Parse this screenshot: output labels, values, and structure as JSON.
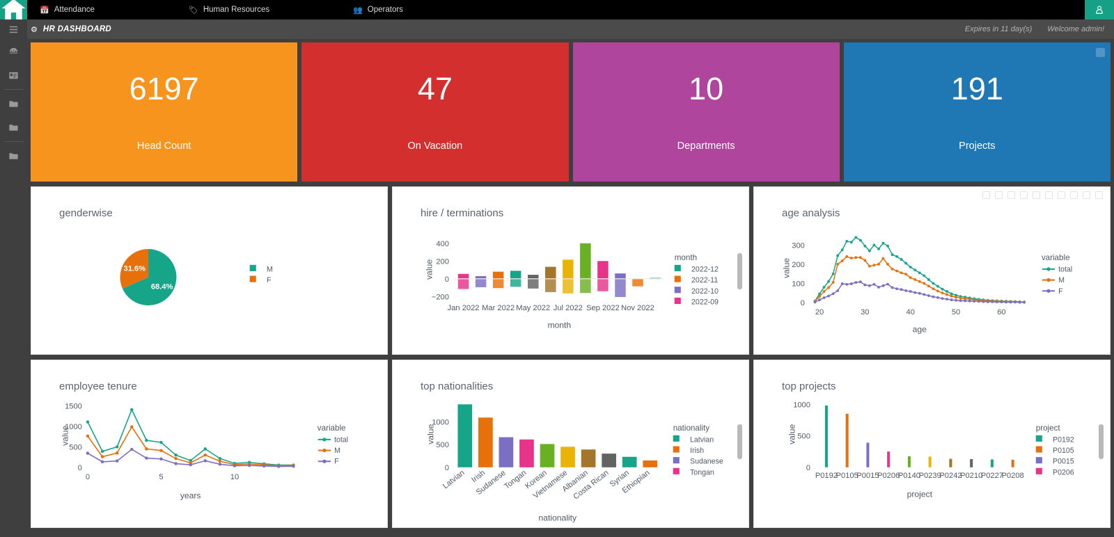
{
  "topbar": {
    "home_icon": "home-icon",
    "links": [
      {
        "label": "Attendance",
        "icon": "calendar-icon"
      },
      {
        "label": "Human Resources",
        "icon": "id-badge-icon"
      },
      {
        "label": "Operators",
        "icon": "users-icon"
      }
    ],
    "user_icon": "user-icon"
  },
  "breadcrumb": {
    "icon": "dashboard-icon",
    "title": "HR DASHBOARD",
    "expires": "Expires in 11 day(s)",
    "welcome": "Welcome admin!"
  },
  "sidebar": {
    "items": [
      {
        "icon": "hamburger-icon",
        "name": "menu-toggle"
      },
      {
        "icon": "speedometer-icon",
        "name": "dashboard"
      },
      {
        "icon": "id-card-icon",
        "name": "employees"
      },
      {
        "icon": "folder-icon",
        "name": "folder-1"
      },
      {
        "icon": "folder-icon",
        "name": "folder-2"
      },
      {
        "icon": "folder-icon",
        "name": "folder-3"
      }
    ]
  },
  "kpis": [
    {
      "value": "6197",
      "label": "Head Count",
      "color": "#f7941e"
    },
    {
      "value": "47",
      "label": "On Vacation",
      "color": "#d32f2f"
    },
    {
      "value": "10",
      "label": "Departments",
      "color": "#b0459e"
    },
    {
      "value": "191",
      "label": "Projects",
      "color": "#1f78b4"
    }
  ],
  "chart_data": [
    {
      "id": "genderwise",
      "type": "pie",
      "title": "genderwise",
      "labels": [
        "M",
        "F"
      ],
      "values": [
        68.4,
        31.6
      ],
      "value_labels": [
        "68.4%",
        "31.6%"
      ],
      "colors": [
        "#17a589",
        "#e8700a"
      ],
      "legend_position": "right",
      "legend_title": ""
    },
    {
      "id": "hire-terminations",
      "type": "bar",
      "title": "hire / terminations",
      "xlabel": "month",
      "ylabel": "value",
      "ylim": [
        -220,
        430
      ],
      "yticks": [
        -200,
        0,
        200,
        400
      ],
      "xticks": [
        "Jan 2022",
        "Mar 2022",
        "May 2022",
        "Jul 2022",
        "Sep 2022",
        "Nov 2022"
      ],
      "legend_title": "month",
      "legend_entries": [
        "2022-12",
        "2022-11",
        "2022-10",
        "2022-09"
      ],
      "legend_colors": [
        "#17a589",
        "#e8700a",
        "#7b6fc4",
        "#e8338a"
      ],
      "categories": [
        "Jan 2022",
        "Feb 2022",
        "Mar 2022",
        "Apr 2022",
        "May 2022",
        "Jun 2022",
        "Jul 2022",
        "Aug 2022",
        "Sep 2022",
        "Oct 2022",
        "Nov 2022",
        "Dec 2022"
      ],
      "pos_values": [
        55,
        30,
        80,
        90,
        45,
        135,
        215,
        400,
        200,
        60,
        0,
        10
      ],
      "neg_values": [
        -115,
        -95,
        -105,
        -90,
        -110,
        -150,
        -165,
        -160,
        -140,
        -205,
        -85,
        -5
      ],
      "bar_colors": [
        "#e8338a",
        "#7b6fc4",
        "#e8700a",
        "#17a589",
        "#636363",
        "#a5762a",
        "#eab308",
        "#6ab023",
        "#e8338a",
        "#7b6fc4",
        "#e8700a",
        "#17a589"
      ]
    },
    {
      "id": "age-analysis",
      "type": "line",
      "title": "age analysis",
      "xlabel": "age",
      "ylabel": "value",
      "ylim": [
        0,
        360
      ],
      "yticks": [
        0,
        100,
        200,
        300
      ],
      "xticks": [
        20,
        30,
        40,
        50,
        60
      ],
      "legend_title": "variable",
      "legend_entries": [
        "total",
        "M",
        "F"
      ],
      "legend_colors": [
        "#17a589",
        "#e8700a",
        "#7b6fc4"
      ],
      "x": [
        19,
        20,
        21,
        22,
        23,
        24,
        25,
        26,
        27,
        28,
        29,
        30,
        31,
        32,
        33,
        34,
        35,
        36,
        37,
        38,
        39,
        40,
        41,
        42,
        43,
        44,
        45,
        46,
        47,
        48,
        49,
        50,
        51,
        52,
        53,
        54,
        55,
        56,
        57,
        58,
        59,
        60,
        61,
        62,
        63,
        64,
        65
      ],
      "series": [
        {
          "name": "total",
          "values": [
            8,
            45,
            80,
            110,
            150,
            245,
            275,
            320,
            315,
            340,
            325,
            295,
            270,
            300,
            280,
            310,
            295,
            250,
            240,
            225,
            205,
            185,
            170,
            155,
            140,
            120,
            100,
            85,
            70,
            58,
            46,
            38,
            32,
            28,
            24,
            20,
            17,
            14,
            12,
            10,
            9,
            8,
            7,
            6,
            5,
            4,
            3
          ]
        },
        {
          "name": "M",
          "values": [
            6,
            32,
            58,
            78,
            105,
            200,
            218,
            240,
            232,
            235,
            235,
            220,
            190,
            195,
            200,
            230,
            200,
            175,
            165,
            155,
            148,
            130,
            120,
            110,
            100,
            86,
            72,
            60,
            50,
            42,
            34,
            28,
            24,
            20,
            17,
            14,
            12,
            10,
            9,
            8,
            7,
            6,
            5,
            5,
            4,
            3,
            3
          ]
        },
        {
          "name": "F",
          "values": [
            2,
            14,
            25,
            34,
            46,
            62,
            98,
            95,
            98,
            105,
            108,
            92,
            88,
            95,
            80,
            88,
            96,
            78,
            72,
            68,
            62,
            58,
            52,
            48,
            42,
            36,
            30,
            26,
            21,
            18,
            14,
            12,
            10,
            9,
            8,
            7,
            6,
            5,
            4,
            4,
            3,
            3,
            2,
            2,
            2,
            1,
            1
          ]
        }
      ]
    },
    {
      "id": "employee-tenure",
      "type": "line",
      "title": "employee tenure",
      "xlabel": "years",
      "ylabel": "value",
      "ylim": [
        0,
        1550
      ],
      "yticks": [
        0,
        500,
        1000,
        1500
      ],
      "xticks": [
        0,
        5,
        10
      ],
      "legend_title": "variable",
      "legend_entries": [
        "total",
        "M",
        "F"
      ],
      "legend_colors": [
        "#17a589",
        "#e8700a",
        "#7b6fc4"
      ],
      "x": [
        0,
        1,
        2,
        3,
        4,
        5,
        6,
        7,
        8,
        9,
        10,
        11,
        12,
        13,
        14
      ],
      "series": [
        {
          "name": "total",
          "values": [
            1110,
            390,
            500,
            1410,
            660,
            610,
            300,
            165,
            450,
            215,
            95,
            120,
            85,
            55,
            55
          ]
        },
        {
          "name": "M",
          "values": [
            765,
            260,
            350,
            990,
            450,
            410,
            215,
            110,
            300,
            150,
            65,
            80,
            58,
            38,
            42
          ]
        },
        {
          "name": "F",
          "values": [
            345,
            135,
            155,
            440,
            225,
            205,
            90,
            62,
            160,
            75,
            38,
            45,
            32,
            22,
            25
          ]
        }
      ]
    },
    {
      "id": "top-nationalities",
      "type": "bar",
      "title": "top nationalities",
      "xlabel": "nationality",
      "ylabel": "value",
      "ylim": [
        0,
        1450
      ],
      "yticks": [
        0,
        500,
        1000
      ],
      "categories": [
        "Latvian",
        "Irish",
        "Sudanese",
        "Tongan",
        "Korean",
        "Vietnamese",
        "Albanian",
        "Costa Rican",
        "Syrian",
        "Ethiopian"
      ],
      "values": [
        1380,
        1090,
        660,
        610,
        510,
        450,
        390,
        300,
        230,
        150
      ],
      "colors": [
        "#17a589",
        "#e8700a",
        "#7b6fc4",
        "#e8338a",
        "#6ab023",
        "#eab308",
        "#a5762a",
        "#636363",
        "#17a589",
        "#e8700a"
      ],
      "legend_title": "nationality",
      "legend_entries": [
        "Latvian",
        "Irish",
        "Sudanese",
        "Tongan"
      ],
      "legend_colors": [
        "#17a589",
        "#e8700a",
        "#7b6fc4",
        "#e8338a"
      ]
    },
    {
      "id": "top-projects",
      "type": "bar",
      "title": "top projects",
      "xlabel": "project",
      "ylabel": "value",
      "ylim": [
        0,
        1050
      ],
      "yticks": [
        0,
        500,
        1000
      ],
      "categories": [
        "P0192",
        "P0105",
        "P0015",
        "P0206",
        "P0140",
        "P0239",
        "P0242",
        "P0210",
        "P0227",
        "P0208"
      ],
      "values": [
        980,
        850,
        390,
        250,
        175,
        170,
        135,
        130,
        125,
        120
      ],
      "colors": [
        "#17a589",
        "#e8700a",
        "#7b6fc4",
        "#e8338a",
        "#6ab023",
        "#eab308",
        "#a5762a",
        "#636363",
        "#17a589",
        "#e8700a"
      ],
      "legend_title": "project",
      "legend_entries": [
        "P0192",
        "P0105",
        "P0015",
        "P0206"
      ],
      "legend_colors": [
        "#17a589",
        "#e8700a",
        "#7b6fc4",
        "#e8338a"
      ]
    }
  ]
}
